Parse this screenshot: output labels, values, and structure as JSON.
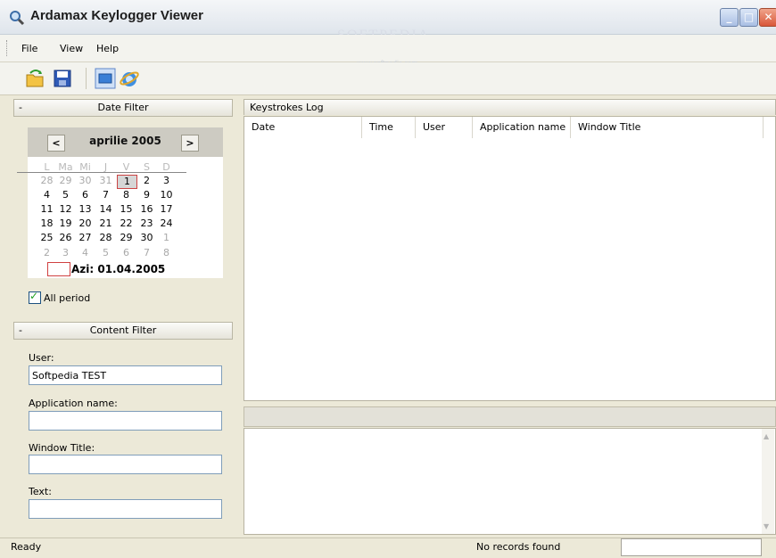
{
  "window": {
    "title": "Ardamax Keylogger Viewer",
    "watermark": "SOFTPEDIA",
    "watermark_sub": "www.softpedia.com",
    "controls": {
      "minimize": "_",
      "maximize": "□",
      "close": "✕"
    }
  },
  "menu": [
    "File",
    "View",
    "Help"
  ],
  "toolbar": {
    "icons": [
      "open-folder-icon",
      "save-disk-icon",
      "display-icon",
      "internet-explorer-icon"
    ]
  },
  "date_filter": {
    "header": "Date Filter",
    "collapse": "-",
    "calendar": {
      "prev": "<",
      "next": ">",
      "month": "aprilie 2005",
      "weekdays": [
        "L",
        "Ma",
        "Mi",
        "J",
        "V",
        "S",
        "D"
      ],
      "weeks": [
        [
          "28",
          "29",
          "30",
          "31",
          "1",
          "2",
          "3"
        ],
        [
          "4",
          "5",
          "6",
          "7",
          "8",
          "9",
          "10"
        ],
        [
          "11",
          "12",
          "13",
          "14",
          "15",
          "16",
          "17"
        ],
        [
          "18",
          "19",
          "20",
          "21",
          "22",
          "23",
          "24"
        ],
        [
          "25",
          "26",
          "27",
          "28",
          "29",
          "30",
          "1"
        ],
        [
          "2",
          "3",
          "4",
          "5",
          "6",
          "7",
          "8"
        ]
      ],
      "today_label": "Azi: 01.04.2005"
    },
    "all_period_label": "All period",
    "all_period_checked": true
  },
  "content_filter": {
    "header": "Content Filter",
    "collapse": "-",
    "user_label": "User:",
    "user_value": "Softpedia TEST",
    "app_label": "Application name:",
    "app_value": "",
    "window_label": "Window Title:",
    "window_value": "",
    "text_label": "Text:",
    "text_value": ""
  },
  "keystrokes_log": {
    "tab": "Keystrokes Log",
    "columns": [
      "Date",
      "Time",
      "User",
      "Application name",
      "Window Title"
    ],
    "rows": []
  },
  "status": {
    "left": "Ready",
    "middle": "No records found",
    "right": ""
  }
}
